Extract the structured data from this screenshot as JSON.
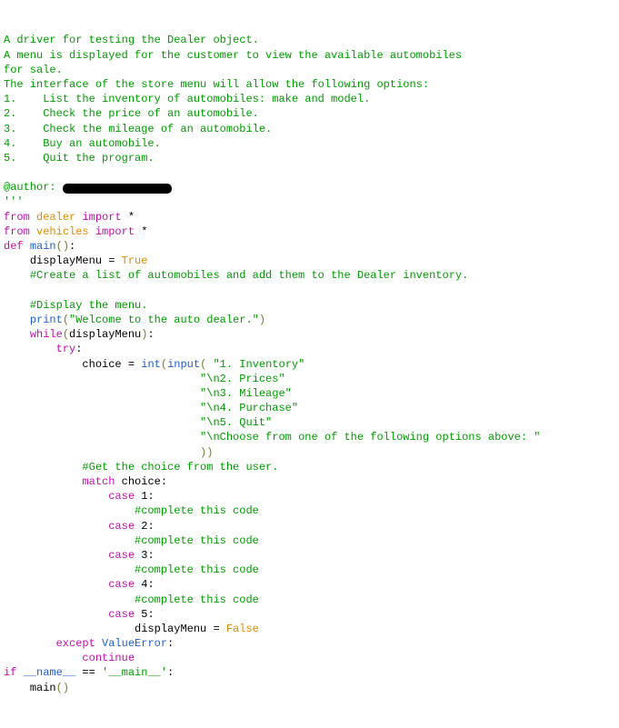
{
  "doc": {
    "l01": "A driver for testing the Dealer object.",
    "l02": "A menu is displayed for the customer to view the available automobiles",
    "l03": "for sale.",
    "l04": "The interface of the store menu will allow the following options:",
    "l05": "1.    List the inventory of automobiles: make and model.",
    "l06": "2.    Check the price of an automobile.",
    "l07": "3.    Check the mileage of an automobile.",
    "l08": "4.    Buy an automobile.",
    "l09": "5.    Quit the program.",
    "l10_author": "@author: ",
    "l11_triplequote": "'''"
  },
  "kw": {
    "from": "from",
    "import": "import",
    "def": "def",
    "while": "while",
    "try": "try",
    "match": "match",
    "case": "case",
    "except": "except",
    "continue": "continue",
    "if": "if"
  },
  "id": {
    "dealer": "dealer",
    "vehicles": "vehicles",
    "star": "*",
    "main": "main",
    "displayMenu": "displayMenu",
    "True": "True",
    "False": "False",
    "print": "print",
    "choice": "choice",
    "int": "int",
    "input": "input",
    "ValueError": "ValueError",
    "dundername": "__name__",
    "dundermain_str": "'__main__'",
    "eqeq": " == "
  },
  "cmt": {
    "create_list": "#Create a list of automobiles and add them to the Dealer inventory.",
    "display_menu": "#Display the menu.",
    "get_choice": "#Get the choice from the user.",
    "complete": "#complete this code"
  },
  "str": {
    "welcome": "\"Welcome to the auto dealer.\"",
    "opt1": "\"1. Inventory\"",
    "opt2": "\"\\n2. Prices\"",
    "opt3": "\"\\n3. Mileage\"",
    "opt4": "\"\\n4. Purchase\"",
    "opt5": "\"\\n5. Quit\"",
    "opt6": "\"\\nChoose from one of the following options above: \""
  },
  "num": {
    "n1": "1",
    "n2": "2",
    "n3": "3",
    "n4": "4",
    "n5": "5"
  },
  "sym": {
    "eq": " = ",
    "colon": ":",
    "op": "(",
    "cp": ")",
    "opcp": "()",
    "closeclose": "))"
  }
}
